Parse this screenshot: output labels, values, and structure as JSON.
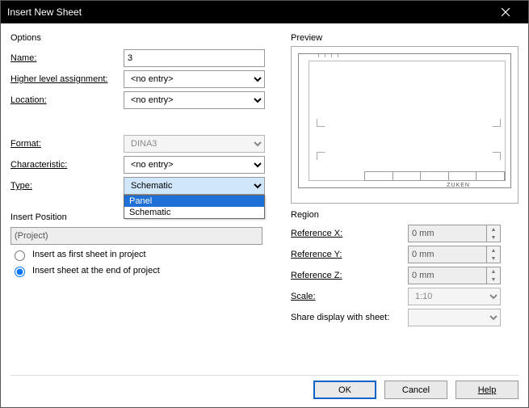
{
  "window": {
    "title": "Insert New Sheet"
  },
  "options": {
    "legend": "Options",
    "name_label": "Name:",
    "name_value": "3",
    "hla_label": "Higher level assignment:",
    "hla_value": "<no entry>",
    "loc_label": "Location:",
    "loc_value": "<no entry>",
    "format_label": "Format:",
    "format_value": "DINA3",
    "char_label": "Characteristic:",
    "char_value": "<no entry>",
    "type_label": "Type:",
    "type_value": "Schematic",
    "type_options": [
      "Panel",
      "Schematic"
    ]
  },
  "insertpos": {
    "legend": "Insert Position",
    "project": "(Project)",
    "r1": "Insert as first sheet in project",
    "r2": "Insert sheet at the end of project"
  },
  "preview": {
    "legend": "Preview",
    "zuken": "ZUKEN"
  },
  "region": {
    "legend": "Region",
    "refx": "Reference X:",
    "refy": "Reference Y:",
    "refz": "Reference Z:",
    "scale": "Scale:",
    "share": "Share display with sheet:",
    "v0": "0 mm",
    "vscale": "1:10"
  },
  "buttons": {
    "ok": "OK",
    "cancel": "Cancel",
    "help": "Help"
  }
}
